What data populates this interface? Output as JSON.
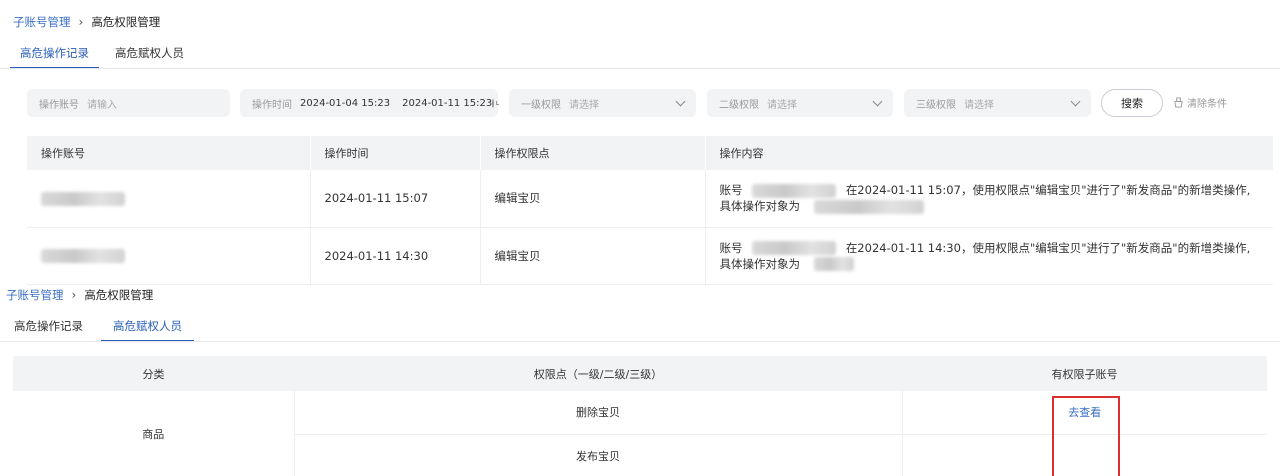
{
  "top": {
    "breadcrumb": {
      "parent": "子账号管理",
      "separator": "›",
      "current": "高危权限管理"
    },
    "tabs": [
      {
        "label": "高危操作记录",
        "active": true
      },
      {
        "label": "高危赋权人员",
        "active": false
      }
    ],
    "filters": {
      "account": {
        "label": "操作账号",
        "placeholder": "请输入"
      },
      "time": {
        "label": "操作时间",
        "start": "2024-01-04 15:23",
        "end": "2024-01-11 15:23"
      },
      "level1": {
        "label": "一级权限",
        "placeholder": "请选择"
      },
      "level2": {
        "label": "二级权限",
        "placeholder": "请选择"
      },
      "level3": {
        "label": "三级权限",
        "placeholder": "请选择"
      },
      "search_label": "搜索",
      "clear_label": "清除条件"
    },
    "table": {
      "headers": [
        "操作账号",
        "操作时间",
        "操作权限点",
        "操作内容"
      ],
      "rows": [
        {
          "time": "2024-01-11 15:07",
          "permission": "编辑宝贝",
          "content_prefix": "账号",
          "content_main": "在2024-01-11 15:07，使用权限点\"编辑宝贝\"进行了\"新发商品\"的新增类操作,",
          "content_line2": "具体操作对象为"
        },
        {
          "time": "2024-01-11 14:30",
          "permission": "编辑宝贝",
          "content_prefix": "账号",
          "content_main": "在2024-01-11 14:30，使用权限点\"编辑宝贝\"进行了\"新发商品\"的新增类操作,",
          "content_line2": "具体操作对象为"
        }
      ]
    }
  },
  "bottom": {
    "breadcrumb": {
      "parent": "子账号管理",
      "separator": "›",
      "current": "高危权限管理"
    },
    "tabs": [
      {
        "label": "高危操作记录",
        "active": false
      },
      {
        "label": "高危赋权人员",
        "active": true
      }
    ],
    "table": {
      "headers": [
        "分类",
        "权限点（一级/二级/三级）",
        "有权限子账号"
      ],
      "category": "商品",
      "permissions": [
        "删除宝贝",
        "发布宝贝"
      ],
      "view_label": "去查看"
    }
  },
  "colors": {
    "accent": "#2a5fb9",
    "link": "#3b6fc4",
    "highlight_border": "#d9302f",
    "header_bg": "#f2f3f5"
  }
}
